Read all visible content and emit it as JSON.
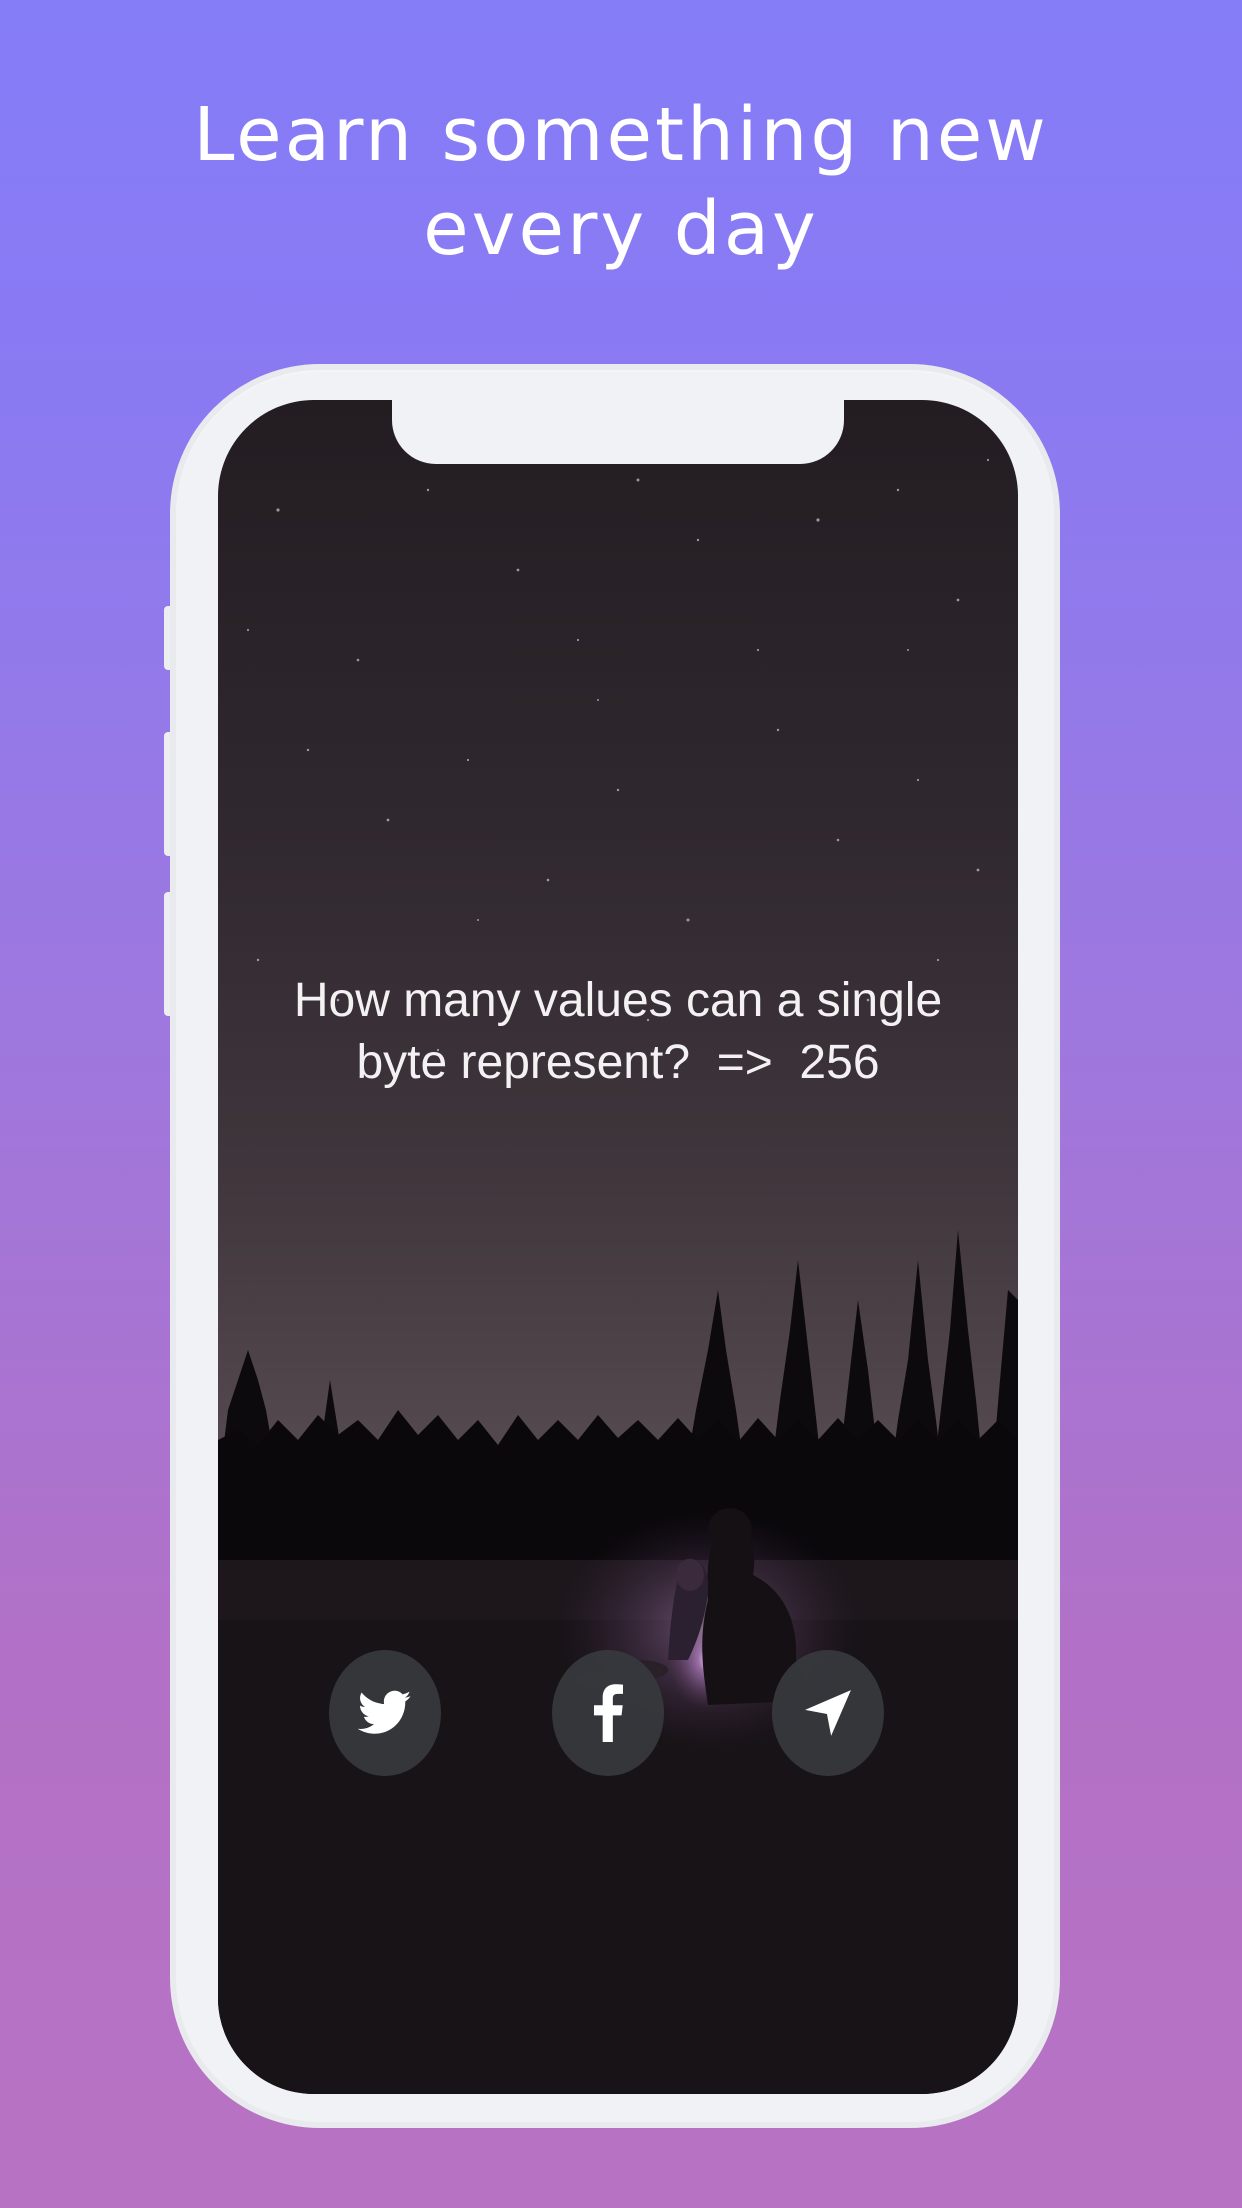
{
  "headline": {
    "line1": "Learn something new",
    "line2": "every day"
  },
  "card": {
    "question_line1": "How many values can a single",
    "question_line2": "byte represent?  =>  256"
  },
  "share_buttons": [
    {
      "icon": "twitter-icon"
    },
    {
      "icon": "facebook-icon"
    },
    {
      "icon": "navigation-arrow-icon"
    }
  ],
  "colors": {
    "background_top": "#857cf8",
    "background_bottom": "#b872c3",
    "phone_frame": "#f1f2f5",
    "button_fill": "#373a3e",
    "text": "#ffffff"
  }
}
